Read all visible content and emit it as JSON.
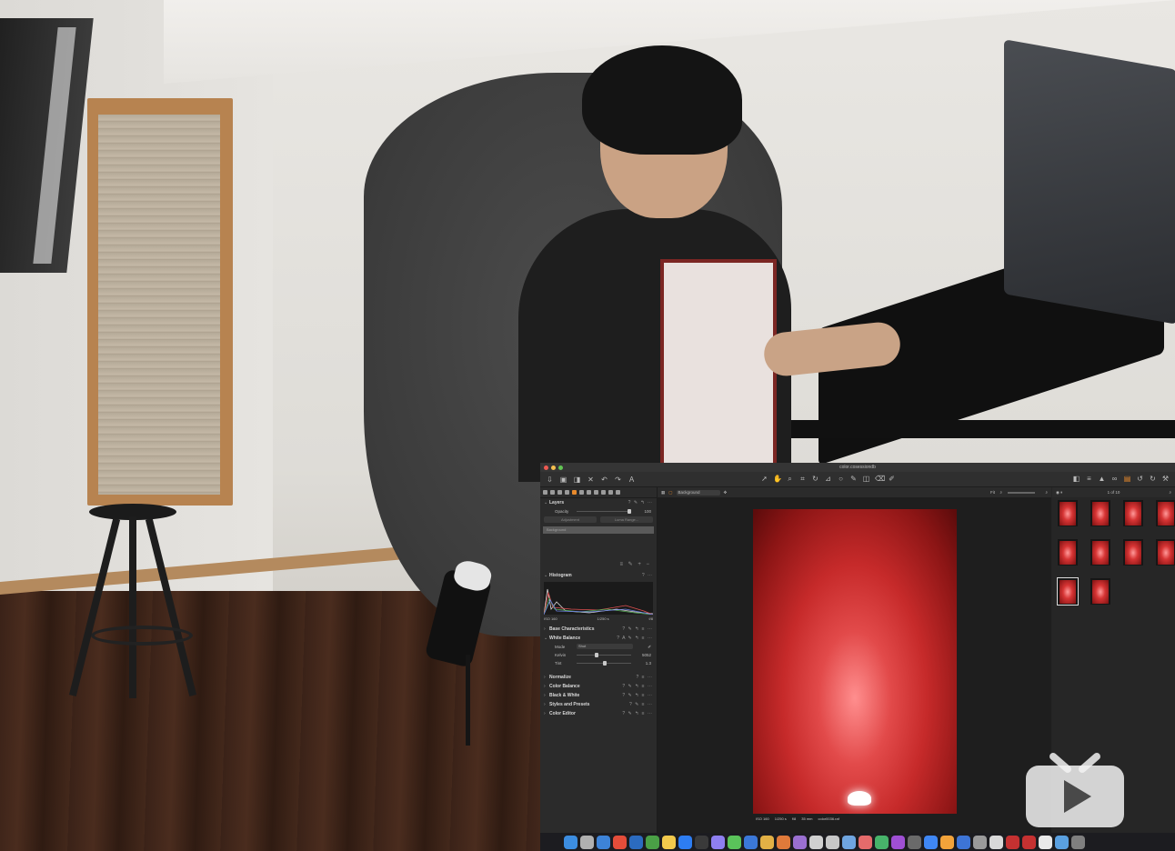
{
  "app": {
    "window_title": "color.cosessiondb",
    "toolbar_icons": [
      "import-icon",
      "camera-icon",
      "process-icon",
      "delete-icon",
      "undo-icon",
      "redo-icon",
      "text-icon"
    ],
    "cursor_tools": [
      "select-icon",
      "pan-icon",
      "loupe-icon",
      "crop-icon",
      "rotate-icon",
      "keystone-icon",
      "spot-icon",
      "brush-icon",
      "gradient-icon",
      "erase-icon",
      "picker-icon"
    ],
    "right_icons": [
      "compare-icon",
      "grid-icon",
      "warning-icon",
      "glasses-icon",
      "orange-icon",
      "rotate-left-icon",
      "rotate-right-icon",
      "wrench-icon"
    ]
  },
  "layers": {
    "title": "Layers",
    "opacity_label": "Opacity",
    "opacity_value": "100",
    "btn_adjustment": "Adjustment",
    "btn_luma_range": "Luma Range...",
    "background_layer": "Background"
  },
  "histogram": {
    "title": "Histogram",
    "iso": "ISO 160",
    "shutter": "1/250 s",
    "aperture": "f/8"
  },
  "tools": [
    {
      "label": "Base Characteristics",
      "expanded": false
    },
    {
      "label": "White Balance",
      "expanded": true
    },
    {
      "label": "Normalize",
      "expanded": false
    },
    {
      "label": "Color Balance",
      "expanded": false
    },
    {
      "label": "Black & White",
      "expanded": false
    },
    {
      "label": "Styles and Presets",
      "expanded": false
    },
    {
      "label": "Color Editor",
      "expanded": false
    }
  ],
  "white_balance": {
    "mode_label": "Mode",
    "mode_value": "Shot",
    "kelvin_label": "Kelvin",
    "kelvin_value": "5052",
    "kelvin_pos": 0.35,
    "tint_label": "Tint",
    "tint_value": "1.3",
    "tint_pos": 0.52
  },
  "viewer": {
    "layer_select": "Background",
    "zoom": "Fit",
    "photo_info": [
      "ISO 160",
      "1/250 s",
      "f/8",
      "35 mm",
      "color0036.raf"
    ]
  },
  "browser": {
    "counter": "1 of 10",
    "thumb_count": 10,
    "selected_index": 8
  },
  "colors": {
    "accent": "#e88a2c",
    "photo_red": "#c62a2a",
    "panel": "#2b2b2b"
  },
  "dock_colors": [
    "#3c8de0",
    "#b0b0b0",
    "#3d83d8",
    "#e44d3a",
    "#2b6bc0",
    "#4aa046",
    "#f2c94c",
    "#2d7df2",
    "#3a3a3a",
    "#8e7ff0",
    "#5ac35a",
    "#3b78d9",
    "#e2b045",
    "#e07a3a",
    "#9a6fd1",
    "#d0d0d0",
    "#c7c7c7",
    "#6fa5e0",
    "#e56b6b",
    "#47b36a",
    "#9f4fd4",
    "#6a6a6a",
    "#3f87f5",
    "#f2a33a",
    "#3d74d6",
    "#9a9a9a",
    "#d9d9d9",
    "#c53131",
    "#c53131",
    "#e9e9e9",
    "#5aa0e0",
    "#7f7f7f"
  ]
}
